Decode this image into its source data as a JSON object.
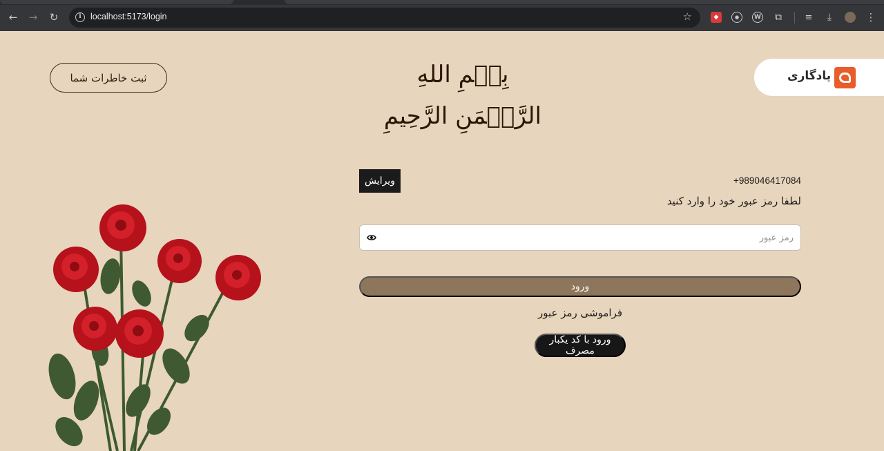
{
  "browser": {
    "url": "localhost:5173/login",
    "icons": {
      "back": "arrow-left-icon",
      "forward": "arrow-right-icon",
      "reload": "reload-icon",
      "site_info": "info-icon",
      "bookmark": "star-icon",
      "downloads": "download-icon",
      "extensions": "puzzle-icon",
      "menu": "kebab-menu-icon"
    }
  },
  "header": {
    "brand_name": "یادگاری",
    "basmala": "بِسۡمِ اللهِ الرَّحۡمَنِ الرَّحِيمِ",
    "memories_button": "ثبت خاطرات شما"
  },
  "login": {
    "edit_button": "ویرایش",
    "phone": "+989046417084",
    "prompt": "لطفا رمز عبور خود را وارد کنید",
    "password_placeholder": "رمز عبور",
    "password_value": "",
    "submit_button": "ورود",
    "forgot_link": "فراموشی رمز عبور",
    "otp_button": "ورود با کد یکبار مصرف"
  },
  "colors": {
    "page_background": "#e8d5bd",
    "primary_button": "#8e765c",
    "dark_button": "#171717",
    "brand_accent": "#e85d2a",
    "rose": "#c0141c",
    "leaf": "#3f5a33"
  }
}
